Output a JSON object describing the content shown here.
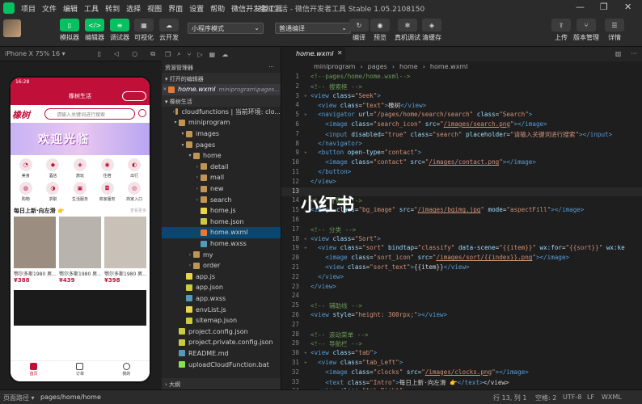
{
  "menubar": {
    "items": [
      "项目",
      "文件",
      "编辑",
      "工具",
      "转到",
      "选择",
      "视图",
      "界面",
      "设置",
      "帮助",
      "微信开发者工具"
    ],
    "title": "橡树生活 - 微信开发者工具 Stable 1.05.2108150"
  },
  "toolbar": {
    "left_buttons": [
      {
        "label": "模拟器",
        "icon": "phone-icon"
      },
      {
        "label": "编辑器",
        "icon": "code-icon"
      },
      {
        "label": "调试器",
        "icon": "debug-icon"
      },
      {
        "label": "可视化",
        "icon": "visual-icon"
      },
      {
        "label": "云开发",
        "icon": "cloud-icon"
      }
    ],
    "mode_select": "小程序模式",
    "compile_select": "普通编译",
    "mid_buttons": [
      {
        "label": "编译",
        "icon": "refresh-icon"
      },
      {
        "label": "预览",
        "icon": "eye-icon"
      },
      {
        "label": "真机调试",
        "icon": "bug-icon"
      },
      {
        "label": "清缓存",
        "icon": "layers-icon"
      }
    ],
    "right_buttons": [
      {
        "label": "上传",
        "icon": "upload-icon"
      },
      {
        "label": "版本管理",
        "icon": "branch-icon"
      },
      {
        "label": "详情",
        "icon": "menu-icon"
      }
    ]
  },
  "simulator": {
    "device": "iPhone X 75% 16 ▾",
    "status_time": "16:28",
    "nav_title": "橡树生活",
    "logo_text": "橡树",
    "search_placeholder": "请输入关键词进行搜索",
    "banner_text": "欢迎光临",
    "categories": [
      "美食",
      "酒店",
      "旅玩",
      "住宿",
      "出行",
      "购物",
      "求职",
      "生活服务",
      "商家服务",
      "商家入口"
    ],
    "hot_title": "每日上新·向左滑 👉",
    "hot_more": "查看更多",
    "products": [
      {
        "name": "鄂尔多斯1980 男...",
        "price": "¥388"
      },
      {
        "name": "鄂尔多斯1980 男...",
        "price": "¥439"
      },
      {
        "name": "鄂尔多斯1980 男...",
        "price": "¥398"
      }
    ],
    "tabs": [
      "首页",
      "订单",
      "我的"
    ]
  },
  "explorer": {
    "title": "资源管理器",
    "open_editors": "打开的编辑器",
    "open_file": "home.wxml",
    "open_file_path": "miniprogram\\pages...",
    "project": "橡树生活",
    "items": [
      {
        "label": "cloudfunctions | 当前环境: clo...",
        "depth": 1,
        "type": "folder"
      },
      {
        "label": "miniprogram",
        "depth": 1,
        "type": "folder"
      },
      {
        "label": "images",
        "depth": 2,
        "type": "folder"
      },
      {
        "label": "pages",
        "depth": 2,
        "type": "folder"
      },
      {
        "label": "home",
        "depth": 3,
        "type": "folder"
      },
      {
        "label": "detail",
        "depth": 4,
        "type": "folder"
      },
      {
        "label": "mall",
        "depth": 4,
        "type": "folder"
      },
      {
        "label": "new",
        "depth": 4,
        "type": "folder"
      },
      {
        "label": "search",
        "depth": 4,
        "type": "folder"
      },
      {
        "label": "home.js",
        "depth": 4,
        "type": "js"
      },
      {
        "label": "home.json",
        "depth": 4,
        "type": "json"
      },
      {
        "label": "home.wxml",
        "depth": 4,
        "type": "wxml"
      },
      {
        "label": "home.wxss",
        "depth": 4,
        "type": "wxss"
      },
      {
        "label": "my",
        "depth": 3,
        "type": "folder"
      },
      {
        "label": "order",
        "depth": 3,
        "type": "folder"
      },
      {
        "label": "app.js",
        "depth": 2,
        "type": "js"
      },
      {
        "label": "app.json",
        "depth": 2,
        "type": "json"
      },
      {
        "label": "app.wxss",
        "depth": 2,
        "type": "wxss"
      },
      {
        "label": "envList.js",
        "depth": 2,
        "type": "js"
      },
      {
        "label": "sitemap.json",
        "depth": 2,
        "type": "json"
      },
      {
        "label": "project.config.json",
        "depth": 1,
        "type": "json"
      },
      {
        "label": "project.private.config.json",
        "depth": 1,
        "type": "json"
      },
      {
        "label": "README.md",
        "depth": 1,
        "type": "md"
      },
      {
        "label": "uploadCloudFunction.bat",
        "depth": 1,
        "type": "bat"
      }
    ],
    "outline": "大纲"
  },
  "editor": {
    "tab": "home.wxml",
    "breadcrumb": [
      "miniprogram",
      "pages",
      "home",
      "home.wxml"
    ],
    "watermark": "小红书",
    "current_line": 13,
    "lines": [
      [
        [
          "c-cm",
          "<!--pages/home/home.wxml-->"
        ]
      ],
      [
        [
          "c-cm",
          "<!-- 搜索框 -->"
        ]
      ],
      [
        [
          "c-tag",
          "<view "
        ],
        [
          "c-at",
          "class"
        ],
        [
          "c-tx",
          "="
        ],
        [
          "c-st",
          "\"Seek\""
        ],
        [
          "c-tag",
          ">"
        ]
      ],
      [
        [
          "c-tx",
          "  "
        ],
        [
          "c-tag",
          "<view "
        ],
        [
          "c-at",
          "class"
        ],
        [
          "c-tx",
          "="
        ],
        [
          "c-st",
          "\"text\""
        ],
        [
          "c-tag",
          ">"
        ],
        [
          "c-tx",
          "橡树"
        ],
        [
          "c-tag",
          "</view>"
        ]
      ],
      [
        [
          "c-tx",
          "  "
        ],
        [
          "c-tag",
          "<navigator "
        ],
        [
          "c-at",
          "url"
        ],
        [
          "c-tx",
          "="
        ],
        [
          "c-st",
          "\"/pages/home/search/search\" "
        ],
        [
          "c-at",
          "class"
        ],
        [
          "c-tx",
          "="
        ],
        [
          "c-st",
          "\"Search\""
        ],
        [
          "c-tag",
          ">"
        ]
      ],
      [
        [
          "c-tx",
          "    "
        ],
        [
          "c-tag",
          "<image "
        ],
        [
          "c-at",
          "class"
        ],
        [
          "c-tx",
          "="
        ],
        [
          "c-st",
          "\"search_icon\" "
        ],
        [
          "c-at",
          "src"
        ],
        [
          "c-tx",
          "="
        ],
        [
          "c-st",
          "\""
        ],
        [
          "c-ul",
          "/images/search.png"
        ],
        [
          "c-st",
          "\""
        ],
        [
          "c-tag",
          "></image>"
        ]
      ],
      [
        [
          "c-tx",
          "    "
        ],
        [
          "c-tag",
          "<input "
        ],
        [
          "c-at",
          "disabled"
        ],
        [
          "c-tx",
          "="
        ],
        [
          "c-st",
          "\"true\" "
        ],
        [
          "c-at",
          "class"
        ],
        [
          "c-tx",
          "="
        ],
        [
          "c-st",
          "\"search\" "
        ],
        [
          "c-at",
          "placeholder"
        ],
        [
          "c-tx",
          "="
        ],
        [
          "c-st",
          "\"请输入关键词进行搜索\""
        ],
        [
          "c-tag",
          "></input>"
        ]
      ],
      [
        [
          "c-tx",
          "  "
        ],
        [
          "c-tag",
          "</navigator>"
        ]
      ],
      [
        [
          "c-tx",
          "  "
        ],
        [
          "c-tag",
          "<button "
        ],
        [
          "c-at",
          "open-type"
        ],
        [
          "c-tx",
          "="
        ],
        [
          "c-st",
          "\"contact\""
        ],
        [
          "c-tag",
          ">"
        ]
      ],
      [
        [
          "c-tx",
          "    "
        ],
        [
          "c-tag",
          "<image "
        ],
        [
          "c-at",
          "class"
        ],
        [
          "c-tx",
          "="
        ],
        [
          "c-st",
          "\"contact\" "
        ],
        [
          "c-at",
          "src"
        ],
        [
          "c-tx",
          "="
        ],
        [
          "c-st",
          "\""
        ],
        [
          "c-ul",
          "/images/contact.png"
        ],
        [
          "c-st",
          "\""
        ],
        [
          "c-tag",
          "></image>"
        ]
      ],
      [
        [
          "c-tx",
          "  "
        ],
        [
          "c-tag",
          "</button>"
        ]
      ],
      [
        [
          "c-tag",
          "</view>"
        ]
      ],
      [],
      [
        [
          "c-cm",
          "<!-- 背景图 -->"
        ]
      ],
      [
        [
          "c-tag",
          "<image "
        ],
        [
          "c-at",
          "class"
        ],
        [
          "c-tx",
          "="
        ],
        [
          "c-st",
          "\"bg_image\" "
        ],
        [
          "c-at",
          "src"
        ],
        [
          "c-tx",
          "="
        ],
        [
          "c-st",
          "\""
        ],
        [
          "c-ul",
          "/images/bgimg.jpg"
        ],
        [
          "c-st",
          "\" "
        ],
        [
          "c-at",
          "mode"
        ],
        [
          "c-tx",
          "="
        ],
        [
          "c-st",
          "\"aspectFill\""
        ],
        [
          "c-tag",
          "></image>"
        ]
      ],
      [],
      [
        [
          "c-cm",
          "<!-- 分类 -->"
        ]
      ],
      [
        [
          "c-tag",
          "<view "
        ],
        [
          "c-at",
          "class"
        ],
        [
          "c-tx",
          "="
        ],
        [
          "c-st",
          "\"Sort\""
        ],
        [
          "c-tag",
          ">"
        ]
      ],
      [
        [
          "c-tx",
          "  "
        ],
        [
          "c-tag",
          "<view "
        ],
        [
          "c-at",
          "class"
        ],
        [
          "c-tx",
          "="
        ],
        [
          "c-st",
          "\"sort\" "
        ],
        [
          "c-at",
          "bindtap"
        ],
        [
          "c-tx",
          "="
        ],
        [
          "c-st",
          "\"classify\" "
        ],
        [
          "c-at",
          "data-scene"
        ],
        [
          "c-tx",
          "="
        ],
        [
          "c-st",
          "\"{{item}}\" "
        ],
        [
          "c-at",
          "wx:for"
        ],
        [
          "c-tx",
          "="
        ],
        [
          "c-st",
          "\"{{sort}}\" "
        ],
        [
          "c-at",
          "wx:ke"
        ]
      ],
      [
        [
          "c-tx",
          "    "
        ],
        [
          "c-tag",
          "<image "
        ],
        [
          "c-at",
          "class"
        ],
        [
          "c-tx",
          "="
        ],
        [
          "c-st",
          "\"sort_icon\" "
        ],
        [
          "c-at",
          "src"
        ],
        [
          "c-tx",
          "="
        ],
        [
          "c-st",
          "\""
        ],
        [
          "c-ul",
          "/images/sort/{{index}}.png"
        ],
        [
          "c-st",
          "\""
        ],
        [
          "c-tag",
          "></image>"
        ]
      ],
      [
        [
          "c-tx",
          "    "
        ],
        [
          "c-tag",
          "<view "
        ],
        [
          "c-at",
          "class"
        ],
        [
          "c-tx",
          "="
        ],
        [
          "c-st",
          "\"sort_text\""
        ],
        [
          "c-tag",
          ">"
        ],
        [
          "c-tx",
          "{{item}}"
        ],
        [
          "c-tag",
          "</view>"
        ]
      ],
      [
        [
          "c-tx",
          "  "
        ],
        [
          "c-tag",
          "</view>"
        ]
      ],
      [
        [
          "c-tag",
          "</view>"
        ]
      ],
      [],
      [
        [
          "c-cm",
          "<!-- 辅助线 -->"
        ]
      ],
      [
        [
          "c-tag",
          "<view "
        ],
        [
          "c-at",
          "style"
        ],
        [
          "c-tx",
          "="
        ],
        [
          "c-st",
          "\"height: 300rpx;\""
        ],
        [
          "c-tag",
          "></view>"
        ]
      ],
      [],
      [
        [
          "c-cm",
          "<!-- 滚动菜单 -->"
        ]
      ],
      [
        [
          "c-cm",
          "<!-- 导航栏 -->"
        ]
      ],
      [
        [
          "c-tag",
          "<view "
        ],
        [
          "c-at",
          "class"
        ],
        [
          "c-tx",
          "="
        ],
        [
          "c-st",
          "\"tab\""
        ],
        [
          "c-tag",
          ">"
        ]
      ],
      [
        [
          "c-tx",
          "  "
        ],
        [
          "c-tag",
          "<view "
        ],
        [
          "c-at",
          "class"
        ],
        [
          "c-tx",
          "="
        ],
        [
          "c-st",
          "\"tab_Left\""
        ],
        [
          "c-tag",
          ">"
        ]
      ],
      [
        [
          "c-tx",
          "    "
        ],
        [
          "c-tag",
          "<image "
        ],
        [
          "c-at",
          "class"
        ],
        [
          "c-tx",
          "="
        ],
        [
          "c-st",
          "\"clocks\" "
        ],
        [
          "c-at",
          "src"
        ],
        [
          "c-tx",
          "="
        ],
        [
          "c-st",
          "\""
        ],
        [
          "c-ul",
          "/images/clocks.png"
        ],
        [
          "c-st",
          "\""
        ],
        [
          "c-tag",
          "></image>"
        ]
      ],
      [
        [
          "c-tx",
          "    "
        ],
        [
          "c-tag",
          "<text "
        ],
        [
          "c-at",
          "class"
        ],
        [
          "c-tx",
          "="
        ],
        [
          "c-st",
          "\"Intro\""
        ],
        [
          "c-tag",
          ">"
        ],
        [
          "c-tx",
          "每日上新·向左滑 👉"
        ],
        [
          "c-tag",
          "</text>"
        ],
        [
          "c-tx",
          "</view>"
        ]
      ],
      [
        [
          "c-tx",
          "  "
        ],
        [
          "c-tag",
          "<view "
        ],
        [
          "c-at",
          "class"
        ],
        [
          "c-tx",
          "="
        ],
        [
          "c-st",
          "\"tab_Right\""
        ],
        [
          "c-tag",
          ">"
        ]
      ]
    ]
  },
  "statusbar": {
    "left": "页面路径 ▾",
    "path": "pages/home/home",
    "position": "行 13, 列 1",
    "spaces": "空格: 2",
    "encoding": "UTF-8",
    "eol": "LF",
    "language": "WXML"
  }
}
